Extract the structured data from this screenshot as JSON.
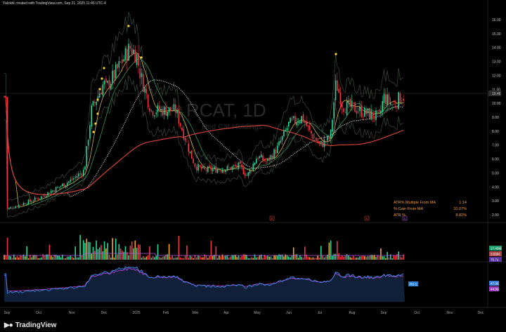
{
  "header": {
    "text": "Yalciktk created with TradingView.com, Sep 21, 2025 11:45 UTC-4"
  },
  "brand": {
    "name": "TradingView"
  },
  "watermark": {
    "symbol": "RCAT, 1D",
    "name": "Red Cat Holdings"
  },
  "stats": [
    {
      "label": "ATR% Multiple From MA",
      "value": "1.14"
    },
    {
      "label": "% Gain From MA",
      "value": "10.07%"
    },
    {
      "label": "ATR %",
      "value": "8.82%"
    }
  ],
  "price_axis": [
    "16.00",
    "15.00",
    "14.00",
    "13.00",
    "12.00",
    "11.00",
    "10.46",
    "10.00",
    "9.00",
    "8.00",
    "7.00",
    "6.00",
    "5.00",
    "4.00",
    "3.00",
    "2.00"
  ],
  "volume_axis": [
    "17.45M",
    "3.93M",
    "75.71"
  ],
  "rs_axis": [
    "RS 1",
    "47.36",
    "44.99"
  ],
  "x_axis": [
    "Sep",
    "Oct",
    "Nov",
    "Dec",
    "2025",
    "Feb",
    "Mar",
    "Apr",
    "May",
    "Jun",
    "Jul",
    "Aug",
    "Sep",
    "Oct",
    "Nov",
    "Dec"
  ],
  "colors": {
    "up": "#26d79a",
    "down": "#f23645",
    "ma_red": "#e0463c",
    "ma_white": "#ffffff",
    "rs_line": "#3a8be8",
    "rs_ma": "#c43fe0",
    "label_orange": "#ff9b2f"
  },
  "chart_data": {
    "type": "candlestick",
    "symbol": "RCAT",
    "interval": "1D",
    "ylim": [
      1.5,
      16.5
    ],
    "last_price": 10.46,
    "events": [
      "E",
      "E",
      "E"
    ],
    "close_by_month": [
      {
        "x": "Sep",
        "close": 2.4
      },
      {
        "x": "Oct",
        "close": 3.2
      },
      {
        "x": "Nov",
        "close": 4.5
      },
      {
        "x": "Dec",
        "close": 11.5
      },
      {
        "x": "2025",
        "close": 13.5
      },
      {
        "x": "Feb",
        "close": 9.5
      },
      {
        "x": "Mar",
        "close": 5.5
      },
      {
        "x": "Apr",
        "close": 5.3
      },
      {
        "x": "May",
        "close": 6.2
      },
      {
        "x": "Jun",
        "close": 8.5
      },
      {
        "x": "Jul",
        "close": 7.0
      },
      {
        "x": "Aug",
        "close": 9.7
      },
      {
        "x": "Sep",
        "close": 10.46
      }
    ]
  }
}
